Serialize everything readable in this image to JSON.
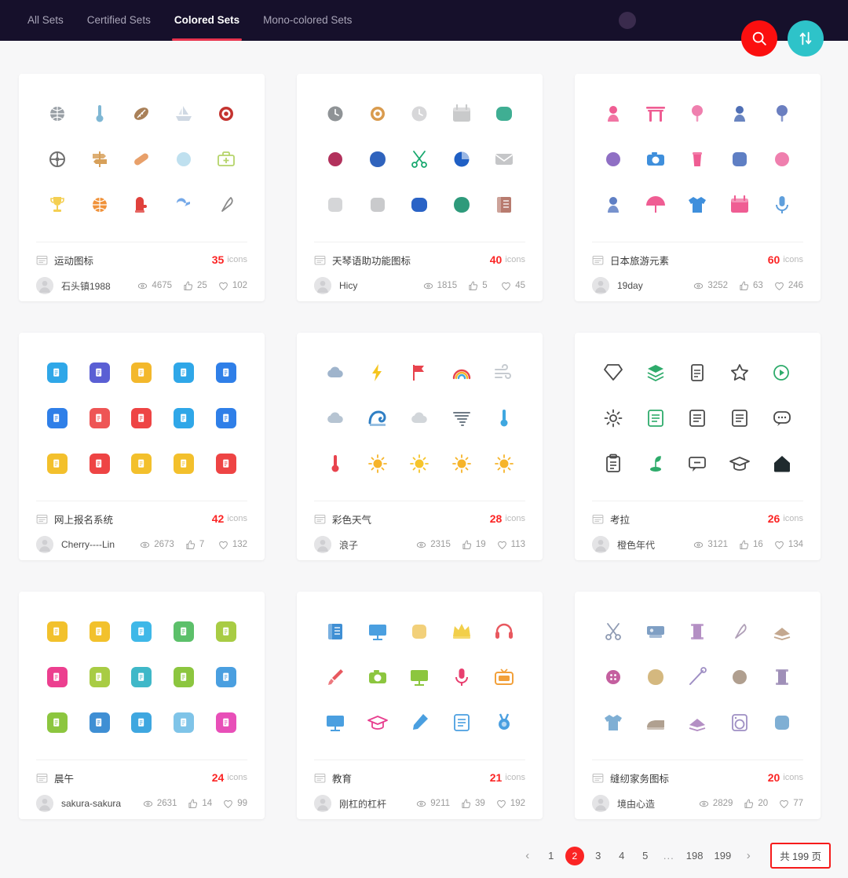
{
  "topbar": {
    "tabs": [
      {
        "label": "All Sets",
        "active": false
      },
      {
        "label": "Certified Sets",
        "active": false
      },
      {
        "label": "Colored Sets",
        "active": true
      },
      {
        "label": "Mono-colored Sets",
        "active": false
      }
    ],
    "search_button": {
      "icon": "search-icon",
      "color": "#fb0f0f"
    },
    "sort_button": {
      "icon": "sort-updown-icon",
      "color": "#2ec3c9"
    },
    "avatar_dot": {
      "color": "#3a2b4d"
    },
    "background": "#16102b",
    "accent": "#e8344e"
  },
  "cards": [
    {
      "name": "运动图标",
      "count": "35",
      "unit": "icons",
      "author": "石头镇1988",
      "views": "4675",
      "likes": "25",
      "favorites": "102",
      "style": "flat-sport",
      "icons": [
        {
          "n": "bowling-ball-icon",
          "c": "#9aa0a6"
        },
        {
          "n": "thermometer-icon",
          "c": "#7fb7d4"
        },
        {
          "n": "football-icon",
          "c": "#a98058"
        },
        {
          "n": "sailboat-icon",
          "c": "#cfd8e3"
        },
        {
          "n": "target-icon",
          "c": "#c4332f"
        },
        {
          "n": "wheel-icon",
          "c": "#6f6f6f"
        },
        {
          "n": "signpost-icon",
          "c": "#d7a05a"
        },
        {
          "n": "bandage-icon",
          "c": "#e8a06a"
        },
        {
          "n": "helmet-icon",
          "c": "#bfe0ef"
        },
        {
          "n": "first-aid-kit-icon",
          "c": "#b5d46a"
        },
        {
          "n": "trophy-icon",
          "c": "#f4cf52"
        },
        {
          "n": "basketball-icon",
          "c": "#f0923a"
        },
        {
          "n": "boxing-glove-icon",
          "c": "#e0413c"
        },
        {
          "n": "whistle-icon",
          "c": "#74a8e8"
        },
        {
          "n": "slingshot-icon",
          "c": "#8a8a8a"
        }
      ]
    },
    {
      "name": "天琴语助功能图标",
      "count": "40",
      "unit": "icons",
      "author": "Hicy",
      "views": "1815",
      "likes": "5",
      "favorites": "45",
      "style": "muted-blob",
      "icons": [
        {
          "n": "alarm-clock-icon",
          "c": "#8f9396"
        },
        {
          "n": "compass-icon",
          "c": "#d99b4e"
        },
        {
          "n": "clock-icon",
          "c": "#d7d7d9"
        },
        {
          "n": "calendar-icon",
          "c": "#c9cacb"
        },
        {
          "n": "battery-icon",
          "c": "#3fae93"
        },
        {
          "n": "record-icon",
          "c": "#b2315c"
        },
        {
          "n": "water-drop-icon",
          "c": "#2f63bd"
        },
        {
          "n": "scissors-icon",
          "c": "#19a86f"
        },
        {
          "n": "pie-chart-icon",
          "c": "#1f5fc4"
        },
        {
          "n": "mail-icon",
          "c": "#c5c6c8"
        },
        {
          "n": "ticket-icon",
          "c": "#d5d6d8"
        },
        {
          "n": "radio-icon",
          "c": "#c9cacc"
        },
        {
          "n": "map-icon",
          "c": "#2a63c6"
        },
        {
          "n": "landscape-icon",
          "c": "#2e9a7b"
        },
        {
          "n": "book-icon",
          "c": "#b87b6f"
        }
      ]
    },
    {
      "name": "日本旅游元素",
      "count": "60",
      "unit": "icons",
      "author": "19day",
      "views": "3252",
      "likes": "63",
      "favorites": "246",
      "style": "pink-blue",
      "icons": [
        {
          "n": "daruma-icon",
          "c": "#ef5d93"
        },
        {
          "n": "torii-gate-icon",
          "c": "#ef5d93"
        },
        {
          "n": "cherry-tree-icon",
          "c": "#ef7fae"
        },
        {
          "n": "kokeshi-doll-icon",
          "c": "#4f6fb5"
        },
        {
          "n": "hydrangea-icon",
          "c": "#6b7fc0"
        },
        {
          "n": "fan-icon",
          "c": "#8f6fc4"
        },
        {
          "n": "camera-icon",
          "c": "#3f8fdc"
        },
        {
          "n": "bubble-tea-icon",
          "c": "#ef5d93"
        },
        {
          "n": "sushi-box-icon",
          "c": "#5f7fc4"
        },
        {
          "n": "mount-fuji-icon",
          "c": "#ef7fae"
        },
        {
          "n": "kokeshi-row-icon",
          "c": "#5f7fc4"
        },
        {
          "n": "umbrella-icon",
          "c": "#ef5d93"
        },
        {
          "n": "kimono-icon",
          "c": "#3f8fdc"
        },
        {
          "n": "calendar-sakura-icon",
          "c": "#ef5d93"
        },
        {
          "n": "microphone-icon",
          "c": "#5f9fdc"
        }
      ]
    },
    {
      "name": "网上报名系统",
      "count": "42",
      "unit": "icons",
      "author": "Cherry----Lin",
      "views": "2673",
      "likes": "7",
      "favorites": "132",
      "style": "tile",
      "icons": [
        {
          "n": "document-tile-icon",
          "c": "#2fa7e8"
        },
        {
          "n": "settings-doc-tile-icon",
          "c": "#5a5fd4"
        },
        {
          "n": "user-tile-icon",
          "c": "#f3b82c"
        },
        {
          "n": "badge-tile-icon",
          "c": "#2fa7e8"
        },
        {
          "n": "edit-tile-icon",
          "c": "#2f7fe8"
        },
        {
          "n": "form-tile-icon",
          "c": "#2f7fe8"
        },
        {
          "n": "comment-tile-icon",
          "c": "#ee5555"
        },
        {
          "n": "review-tile-icon",
          "c": "#ee4444"
        },
        {
          "n": "copy-tile-icon",
          "c": "#2fa7e8"
        },
        {
          "n": "gear-doc-tile-icon",
          "c": "#2f7fe8"
        },
        {
          "n": "search-doc-tile-icon",
          "c": "#f3c02c"
        },
        {
          "n": "delete-tile-icon",
          "c": "#ee4444"
        },
        {
          "n": "list-tile-icon",
          "c": "#f3c02c"
        },
        {
          "n": "report-tile-icon",
          "c": "#f3c02c"
        },
        {
          "n": "print-tile-icon",
          "c": "#ee4444"
        }
      ]
    },
    {
      "name": "彩色天气",
      "count": "28",
      "unit": "icons",
      "author": "浪子",
      "views": "2315",
      "likes": "19",
      "favorites": "113",
      "style": "weather",
      "icons": [
        {
          "n": "rain-icon",
          "c": "#9fb4cc"
        },
        {
          "n": "thunderstorm-icon",
          "c": "#f5c51f"
        },
        {
          "n": "wind-flag-icon",
          "c": "#e8434d"
        },
        {
          "n": "rainbow-icon",
          "c": "#3fa7e0"
        },
        {
          "n": "wind-icon",
          "c": "#c6cbd0"
        },
        {
          "n": "drizzle-icon",
          "c": "#b6c4d2"
        },
        {
          "n": "tsunami-icon",
          "c": "#2f7fc4"
        },
        {
          "n": "cloud-icon",
          "c": "#d2d6da"
        },
        {
          "n": "tornado-icon",
          "c": "#6f7b86"
        },
        {
          "n": "thermometer-snow-icon",
          "c": "#3fa7e0"
        },
        {
          "n": "thermometer-sun-icon",
          "c": "#e8434d"
        },
        {
          "n": "sunrise-icon",
          "c": "#f6b42a"
        },
        {
          "n": "partly-cloudy-icon",
          "c": "#f6c42a"
        },
        {
          "n": "sun-icon",
          "c": "#f6b42a"
        },
        {
          "n": "sunny-icon",
          "c": "#f6b42a"
        }
      ]
    },
    {
      "name": "考拉",
      "count": "26",
      "unit": "icons",
      "author": "橙色年代",
      "views": "3121",
      "likes": "16",
      "favorites": "134",
      "style": "line-green",
      "icons": [
        {
          "n": "diamond-icon",
          "c": "#4a4a4a"
        },
        {
          "n": "layers-icon",
          "c": "#2eab6b"
        },
        {
          "n": "document-icon",
          "c": "#4a4a4a"
        },
        {
          "n": "star-icon",
          "c": "#4a4a4a"
        },
        {
          "n": "play-signal-icon",
          "c": "#2eab6b"
        },
        {
          "n": "gear-icon",
          "c": "#4a4a4a"
        },
        {
          "n": "notebook-icon",
          "c": "#2eab6b"
        },
        {
          "n": "address-book-icon",
          "c": "#4a4a4a"
        },
        {
          "n": "note-edit-icon",
          "c": "#4a4a4a"
        },
        {
          "n": "chat-icon",
          "c": "#4a4a4a"
        },
        {
          "n": "clipboard-icon",
          "c": "#4a4a4a"
        },
        {
          "n": "plant-icon",
          "c": "#2eab6b"
        },
        {
          "n": "message-minus-icon",
          "c": "#4a4a4a"
        },
        {
          "n": "graduation-cap-icon",
          "c": "#4a4a4a"
        },
        {
          "n": "home-icon",
          "c": "#1f2a2e"
        }
      ]
    },
    {
      "name": "晨午",
      "count": "24",
      "unit": "icons",
      "author": "sakura-sakura",
      "views": "2631",
      "likes": "14",
      "favorites": "99",
      "style": "tile",
      "icons": [
        {
          "n": "book-tile-icon",
          "c": "#f2c12c"
        },
        {
          "n": "award-tile-icon",
          "c": "#f2c12c"
        },
        {
          "n": "edit-tile-icon",
          "c": "#3fb8e8"
        },
        {
          "n": "search-user-tile-icon",
          "c": "#5cc06a"
        },
        {
          "n": "archive-tile-icon",
          "c": "#a8cc44"
        },
        {
          "n": "layers-tile-icon",
          "c": "#ec3f8f"
        },
        {
          "n": "chat-tile-icon",
          "c": "#a8cc44"
        },
        {
          "n": "book-open-tile-icon",
          "c": "#3fb8c8"
        },
        {
          "n": "clipboard-user-tile-icon",
          "c": "#8cc63f"
        },
        {
          "n": "doc-gear-tile-icon",
          "c": "#4a9fe0"
        },
        {
          "n": "image-tile-icon",
          "c": "#8cc63f"
        },
        {
          "n": "chart-tile-icon",
          "c": "#3f8fd4"
        },
        {
          "n": "camera-tile-icon",
          "c": "#3fa7e0"
        },
        {
          "n": "list-tile-icon",
          "c": "#7fc4e8"
        },
        {
          "n": "signature-tile-icon",
          "c": "#e84fb8"
        }
      ]
    },
    {
      "name": "教育",
      "count": "21",
      "unit": "icons",
      "author": "刚杠的杠杆",
      "views": "9211",
      "likes": "39",
      "favorites": "192",
      "style": "flat-edu",
      "icons": [
        {
          "n": "book-icon",
          "c": "#3f8fd4"
        },
        {
          "n": "projector-icon",
          "c": "#4a9fe0"
        },
        {
          "n": "browser-icon",
          "c": "#f2d07a"
        },
        {
          "n": "crown-icon",
          "c": "#f2cf4a"
        },
        {
          "n": "headphones-icon",
          "c": "#e8585f"
        },
        {
          "n": "paintbrush-icon",
          "c": "#e8585f"
        },
        {
          "n": "video-camera-icon",
          "c": "#8cc63f"
        },
        {
          "n": "whiteboard-icon",
          "c": "#8cc63f"
        },
        {
          "n": "microphone-icon",
          "c": "#e83f6f"
        },
        {
          "n": "tv-icon",
          "c": "#f2a03a"
        },
        {
          "n": "easel-icon",
          "c": "#4a9fe0"
        },
        {
          "n": "graduation-box-icon",
          "c": "#e83f8f"
        },
        {
          "n": "pencil-ruler-icon",
          "c": "#4a9fe0"
        },
        {
          "n": "notebook-icon",
          "c": "#4a9fe0"
        },
        {
          "n": "medal-icon",
          "c": "#4a9fe0"
        }
      ]
    },
    {
      "name": "缝纫家务图标",
      "count": "20",
      "unit": "icons",
      "author": "境由心造",
      "views": "2829",
      "likes": "20",
      "favorites": "77",
      "style": "pastel-line",
      "icons": [
        {
          "n": "scissors-icon",
          "c": "#8f9bb3"
        },
        {
          "n": "sewing-machine-icon",
          "c": "#7f9fc4"
        },
        {
          "n": "thread-spool-icon",
          "c": "#b48fc4"
        },
        {
          "n": "safety-pin-icon",
          "c": "#b0a0b8"
        },
        {
          "n": "fabric-stack-icon",
          "c": "#c4a88f"
        },
        {
          "n": "button-icon",
          "c": "#c45f9f"
        },
        {
          "n": "leather-icon",
          "c": "#d4b87f"
        },
        {
          "n": "needle-thread-icon",
          "c": "#9f8fc4"
        },
        {
          "n": "knot-icon",
          "c": "#b09f8f"
        },
        {
          "n": "bobbin-icon",
          "c": "#9f8fb8"
        },
        {
          "n": "shirt-icon",
          "c": "#7fafd4"
        },
        {
          "n": "iron-icon",
          "c": "#b0a090"
        },
        {
          "n": "folded-cloth-icon",
          "c": "#b48fc4"
        },
        {
          "n": "washing-machine-icon",
          "c": "#9f8fc4"
        },
        {
          "n": "fabric-swatch-icon",
          "c": "#7fafd4"
        }
      ]
    }
  ],
  "pagination": {
    "prev": "‹",
    "next": "›",
    "pages": [
      "1",
      "2",
      "3",
      "4",
      "5"
    ],
    "ellipsis": "...",
    "tail_pages": [
      "198",
      "199"
    ],
    "current": "2",
    "total_label": "共 199 页"
  }
}
